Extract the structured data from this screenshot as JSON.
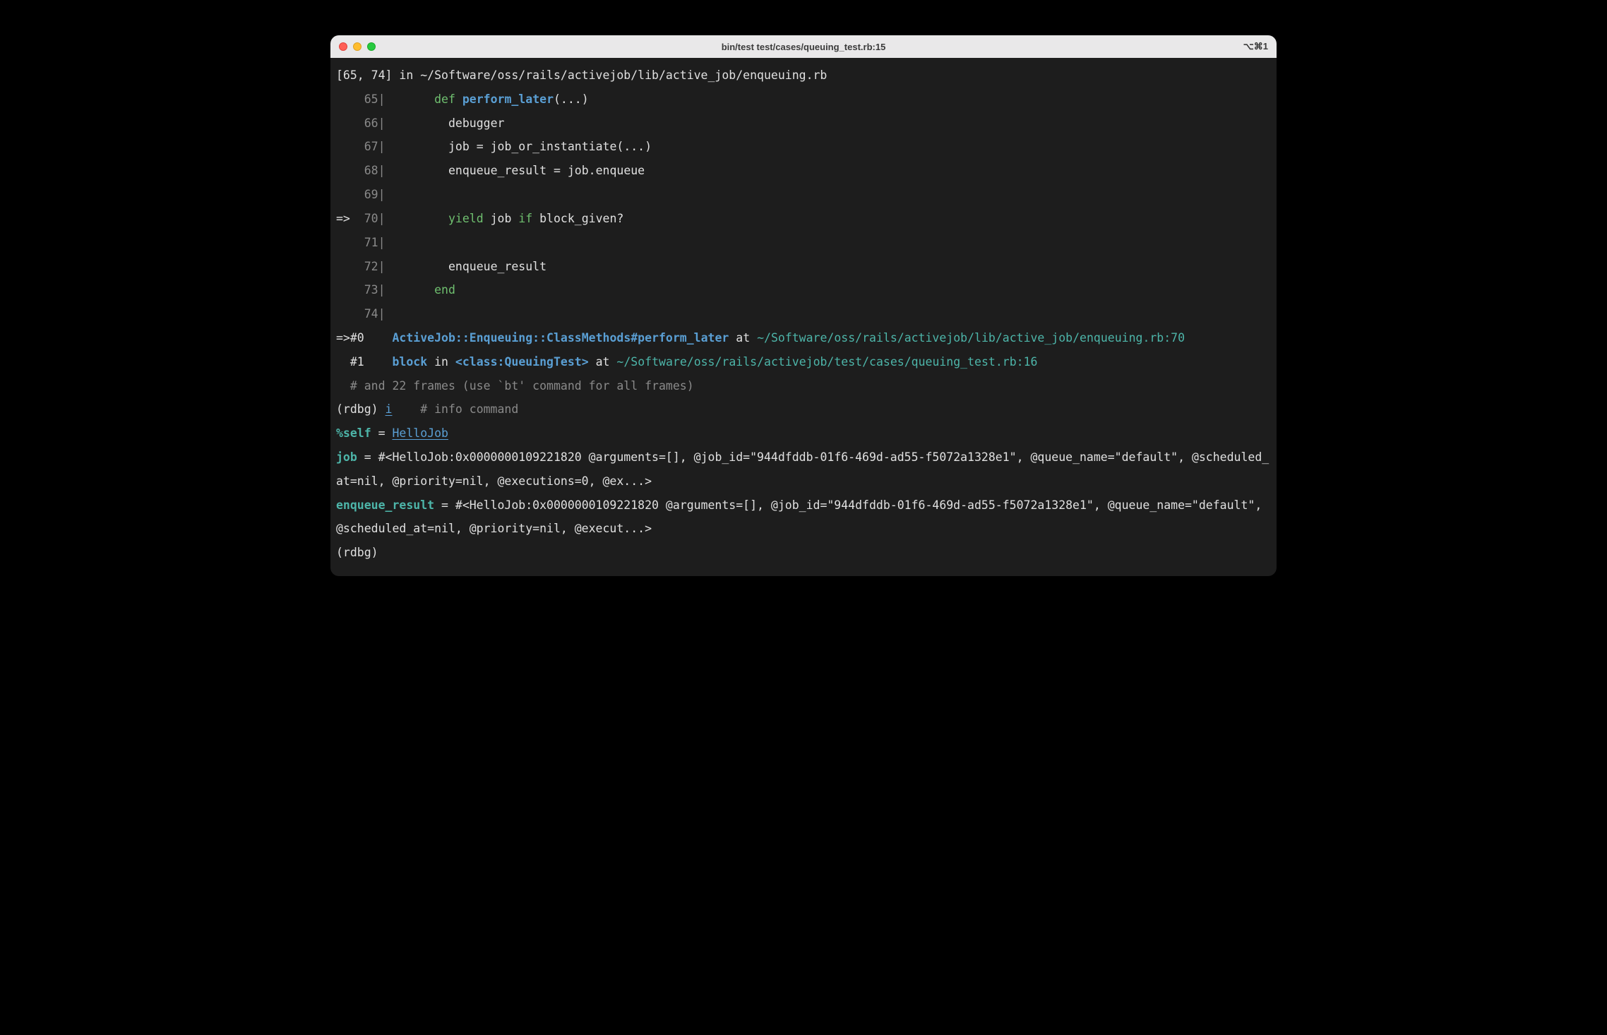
{
  "window": {
    "title": "bin/test test/cases/queuing_test.rb:15",
    "shortcut": "⌥⌘1"
  },
  "source": {
    "range": "[65, 74] in ~/Software/oss/rails/activejob/lib/active_job/enqueuing.rb",
    "lines": {
      "l65_no": "65",
      "l65_kw": "def",
      "l65_name": "perform_later",
      "l65_rest": "(...)",
      "l66_no": "66",
      "l66": "debugger",
      "l67_no": "67",
      "l67": "job = job_or_instantiate(...)",
      "l68_no": "68",
      "l68": "enqueue_result = job.enqueue",
      "l69_no": "69",
      "l70_no": "70",
      "l70_kw_yield": "yield",
      "l70_mid": " job ",
      "l70_kw_if": "if",
      "l70_rest": " block_given?",
      "l71_no": "71",
      "l72_no": "72",
      "l72": "enqueue_result",
      "l73_no": "73",
      "l73": "end",
      "l74_no": "74"
    }
  },
  "frames": {
    "f0_marker": "=>#0",
    "f0_method": "ActiveJob::Enqueuing::ClassMethods#perform_later",
    "f0_at": " at ",
    "f0_loc": "~/Software/oss/rails/activejob/lib/active_job/enqueuing.rb:70",
    "f1_marker": "  #1",
    "f1_block": "block",
    "f1_in": " in ",
    "f1_class": "<class:QueuingTest>",
    "f1_at": " at ",
    "f1_loc": "~/Software/oss/rails/activejob/test/cases/queuing_test.rb:16",
    "more": "  # and 22 frames (use `bt' command for all frames)"
  },
  "repl": {
    "prompt1_pre": "(rdbg) ",
    "prompt1_cmd": "i",
    "prompt1_comment": "    # info command",
    "self_label": "%self",
    "self_eq": " = ",
    "self_val": "HelloJob",
    "job_label": "job",
    "job_val": " = #<HelloJob:0x0000000109221820 @arguments=[], @job_id=\"944dfddb-01f6-469d-ad55-f5072a1328e1\", @queue_name=\"default\", @scheduled_at=nil, @priority=nil, @executions=0, @ex...>",
    "enq_label": "enqueue_result",
    "enq_val": " = #<HelloJob:0x0000000109221820 @arguments=[], @job_id=\"944dfddb-01f6-469d-ad55-f5072a1328e1\", @queue_name=\"default\", @scheduled_at=nil, @priority=nil, @execut...>",
    "prompt2": "(rdbg) "
  }
}
